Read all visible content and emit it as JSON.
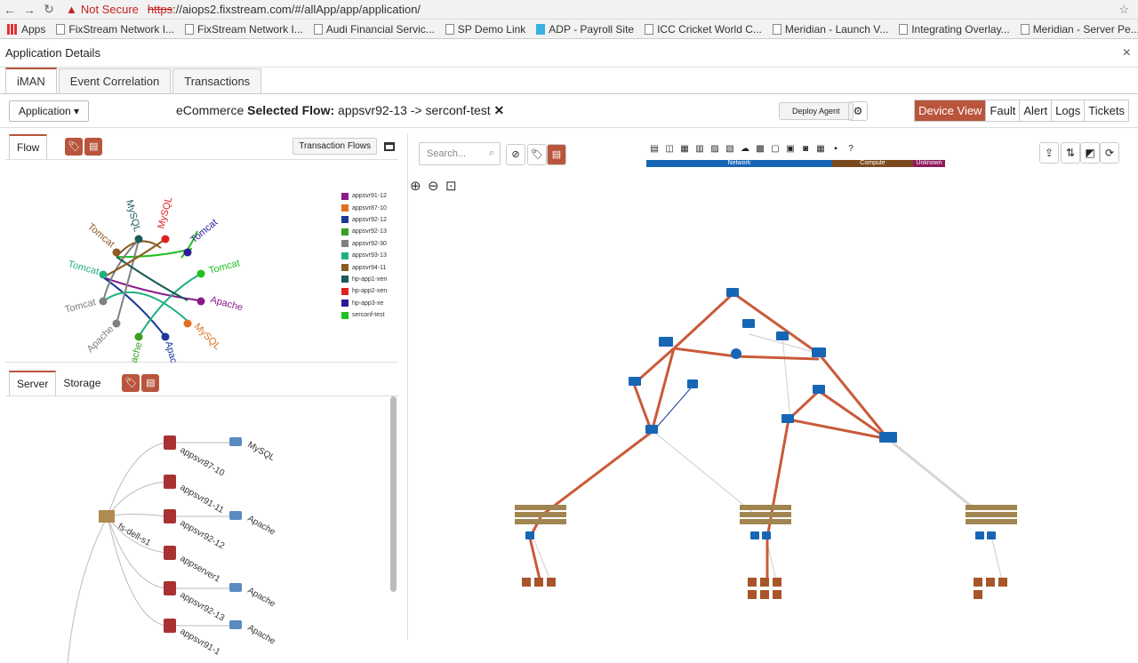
{
  "browser": {
    "security": "Not Secure",
    "url_proto": "https",
    "url_rest": "://aiops2.fixstream.com/#/allApp/app/application/"
  },
  "bookmarks": [
    "Apps",
    "FixStream Network I...",
    "FixStream Network I...",
    "Audi Financial Servic...",
    "SP Demo Link",
    "ADP - Payroll Site",
    "ICC Cricket World C...",
    "Meridian - Launch V...",
    "Integrating Overlay...",
    "Meridian - Server Pe..."
  ],
  "window": {
    "title": "Application Details",
    "close": "×"
  },
  "tabs": [
    "iMAN",
    "Event Correlation",
    "Transactions"
  ],
  "toolbar": {
    "app_dropdown": "Application ▾",
    "flow_prefix": "eCommerce ",
    "flow_bold": "Selected Flow:",
    "flow_value": " appsvr92-13 -> serconf-test",
    "deploy_label": "Deploy Agent",
    "views": [
      "Device View",
      "Fault",
      "Alert",
      "Logs",
      "Tickets"
    ]
  },
  "flow_panel": {
    "tab": "Flow",
    "transaction_flows": "Transaction Flows",
    "legend": [
      {
        "label": "appsvr91-12",
        "color": "#8b1a8b"
      },
      {
        "label": "appsvr87-10",
        "color": "#e07020"
      },
      {
        "label": "appsvr92-12",
        "color": "#1a3a9a"
      },
      {
        "label": "appsvr92-13",
        "color": "#3aa020"
      },
      {
        "label": "appsvr92-30",
        "color": "#808080"
      },
      {
        "label": "appsvr93-13",
        "color": "#20b080"
      },
      {
        "label": "appsvr94-11",
        "color": "#8b5a20"
      },
      {
        "label": "hp-app1-xen",
        "color": "#1a5a5a"
      },
      {
        "label": "hp-app2-xen",
        "color": "#e02020"
      },
      {
        "label": "hp-app3-xe",
        "color": "#2a1a9a"
      },
      {
        "label": "serconf-test",
        "color": "#20c020"
      }
    ],
    "nodes": [
      "Tomcat",
      "MySQL",
      "MySQL",
      "Tomcat",
      "Apache",
      "MySQL",
      "Apache",
      "Apache",
      "Apache",
      "Tomcat",
      "Tomcat",
      "Tomcat"
    ]
  },
  "server_panel": {
    "tabs": [
      "Server",
      "Storage"
    ],
    "root": "fs-dell-s1",
    "servers": [
      "appsvr87-10",
      "appsvr91-11",
      "appsvr92-12",
      "appserver1",
      "appsvr92-13",
      "appsvr91-1"
    ],
    "apps": [
      "MySQL",
      "Apache",
      "Apache",
      "Apache"
    ]
  },
  "topology": {
    "search_placeholder": "Search...",
    "categories": [
      "Network",
      "Compute",
      "Unknown"
    ],
    "colors": {
      "link": "#c95a3a",
      "accent": "#b8553c",
      "network": "#1766b5",
      "compute": "#7a4a1e",
      "unknown": "#8e1a5c"
    }
  }
}
